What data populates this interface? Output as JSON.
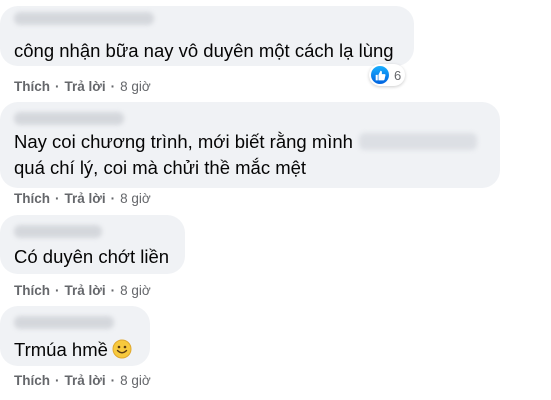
{
  "comments": [
    {
      "text": "công nhận bữa nay vô duyên một cách lạ lùng",
      "reactions": {
        "icon": "like-icon",
        "count": "6"
      },
      "actions": {
        "like": "Thích",
        "reply": "Trả lời",
        "time": "8 giờ"
      }
    },
    {
      "text_line1": "Nay coi chương trình, mới biết rằng mình",
      "text_line2": "quá chí lý, coi mà chửi thề mắc mệt",
      "actions": {
        "like": "Thích",
        "reply": "Trả lời",
        "time": "8 giờ"
      }
    },
    {
      "text": "Có duyên chớt liền",
      "actions": {
        "like": "Thích",
        "reply": "Trả lời",
        "time": "8 giờ"
      }
    },
    {
      "text": "Trmúa hmề",
      "emoji": "smiling-face-icon",
      "actions": {
        "like": "Thích",
        "reply": "Trả lời",
        "time": "8 giờ"
      }
    }
  ],
  "colors": {
    "bubble": "#f0f2f5",
    "meta": "#65676b",
    "like_blue": "#1877f2"
  }
}
